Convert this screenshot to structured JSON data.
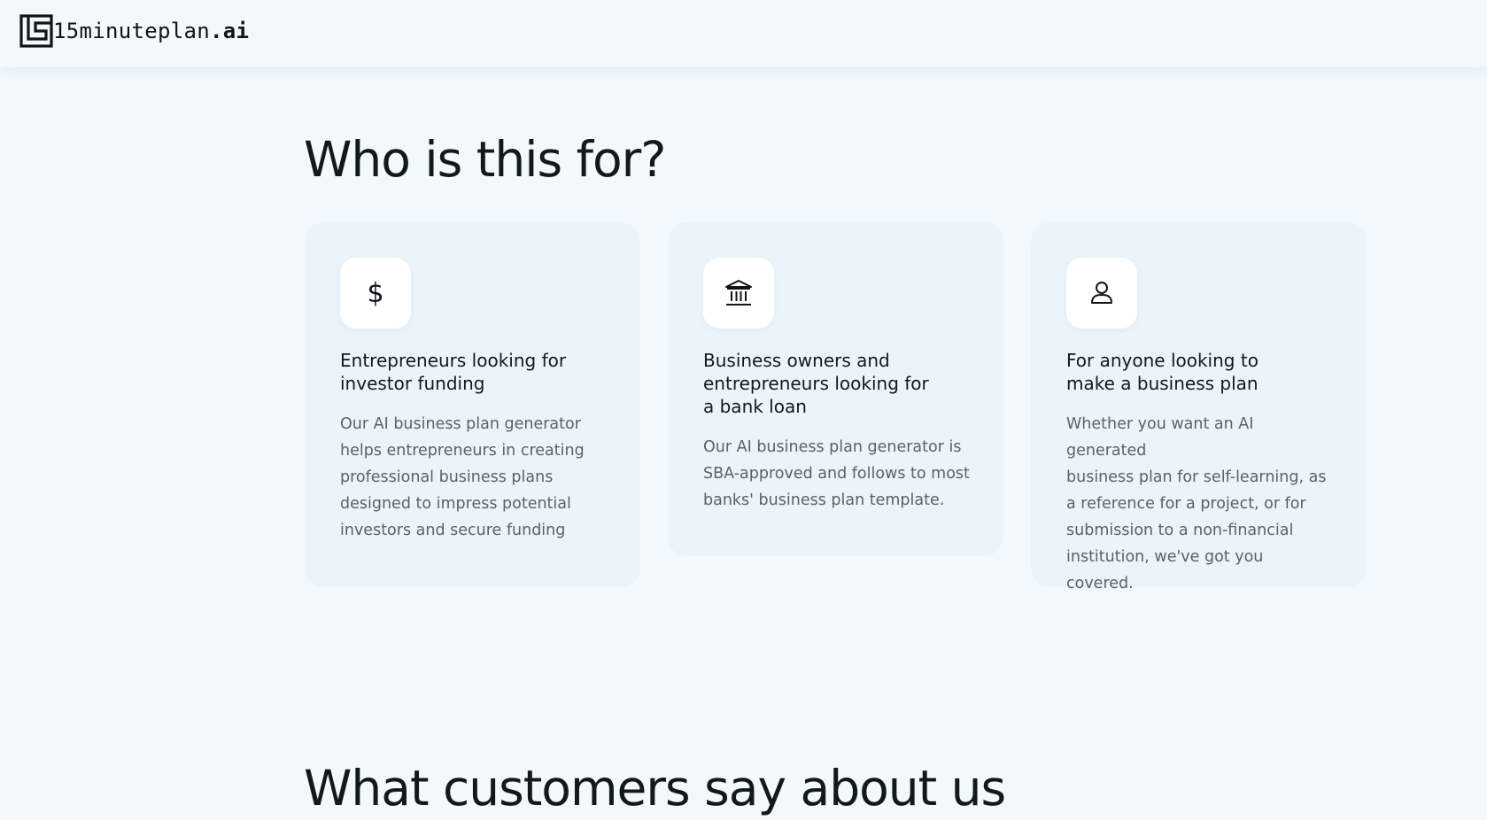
{
  "header": {
    "logo_text": "15minuteplan",
    "logo_tld": ".ai"
  },
  "who_section": {
    "title": "Who is this for?",
    "cards": [
      {
        "icon": "dollar-sign-icon",
        "title": "Entrepreneurs looking for\ninvestor funding",
        "text": "Our AI business plan generator\nhelps entrepreneurs in creating\nprofessional business plans\ndesigned to impress potential\ninvestors and secure funding"
      },
      {
        "icon": "bank-icon",
        "title": "Business owners and\nentrepreneurs looking for\na bank loan",
        "text": "Our AI business plan generator is\nSBA-approved and follows to most\nbanks' business plan template."
      },
      {
        "icon": "user-icon",
        "title": "For anyone looking to\nmake a business plan",
        "text": "Whether you want an AI generated\nbusiness plan for self-learning, as\na reference for a project, or for\nsubmission to a non-financial\ninstitution, we've got you covered."
      }
    ]
  },
  "testimonials_section": {
    "title": "What customers say about us"
  },
  "colors": {
    "page_background": "#f1f8fe",
    "card_background": "#ebf3fb",
    "heading": "#14171b",
    "body_text": "#5b6168"
  }
}
